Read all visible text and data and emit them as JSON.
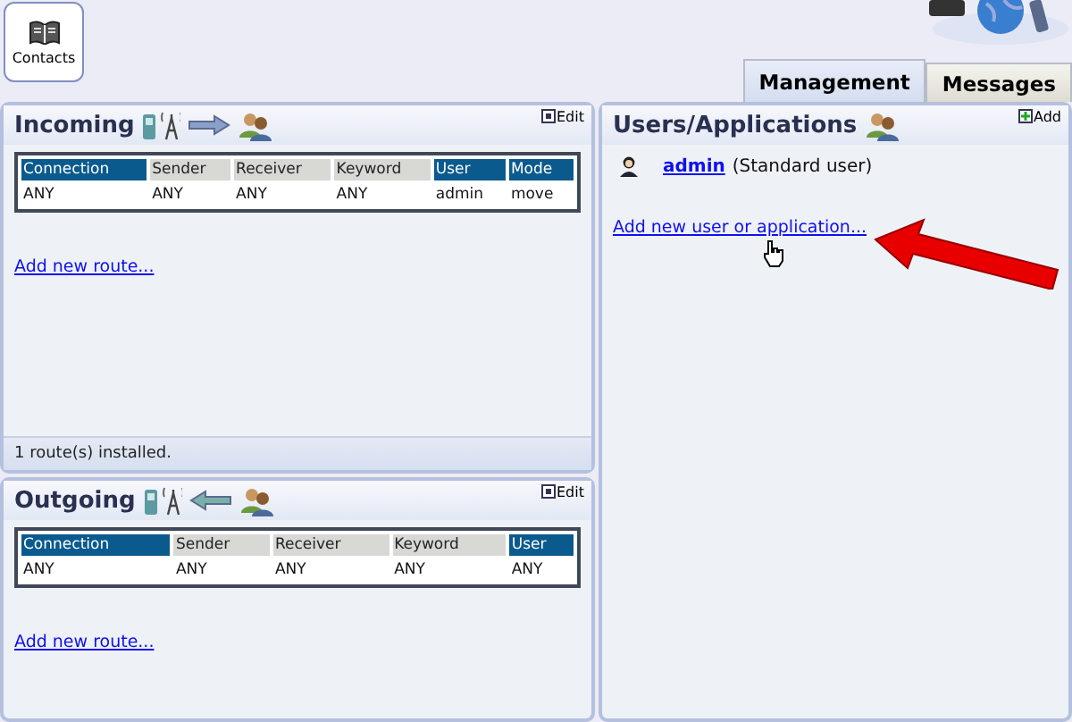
{
  "toolbar": {
    "contacts_button": "Contacts"
  },
  "tabs": [
    {
      "label": "Management",
      "selected": true
    },
    {
      "label": "Messages",
      "selected": false
    }
  ],
  "incoming": {
    "title": "Incoming",
    "edit": "Edit",
    "columns": [
      {
        "label": "Connection",
        "highlighted": true
      },
      {
        "label": "Sender",
        "highlighted": false
      },
      {
        "label": "Receiver",
        "highlighted": false
      },
      {
        "label": "Keyword",
        "highlighted": false
      },
      {
        "label": "User",
        "highlighted": true
      },
      {
        "label": "Mode",
        "highlighted": true
      }
    ],
    "rows": [
      [
        "ANY",
        "ANY",
        "ANY",
        "ANY",
        "admin",
        "move"
      ]
    ],
    "add_link": "Add new route...",
    "status": "1 route(s) installed."
  },
  "outgoing": {
    "title": "Outgoing",
    "edit": "Edit",
    "columns": [
      {
        "label": "Connection",
        "highlighted": true
      },
      {
        "label": "Sender",
        "highlighted": false
      },
      {
        "label": "Receiver",
        "highlighted": false
      },
      {
        "label": "Keyword",
        "highlighted": false
      },
      {
        "label": "User",
        "highlighted": true
      }
    ],
    "rows": [
      [
        "ANY",
        "ANY",
        "ANY",
        "ANY",
        "ANY"
      ]
    ],
    "add_link": "Add new route..."
  },
  "users": {
    "title": "Users/Applications",
    "add": "Add",
    "items": [
      {
        "name": "admin",
        "role": "(Standard user)"
      }
    ],
    "add_link": "Add new user or application..."
  }
}
